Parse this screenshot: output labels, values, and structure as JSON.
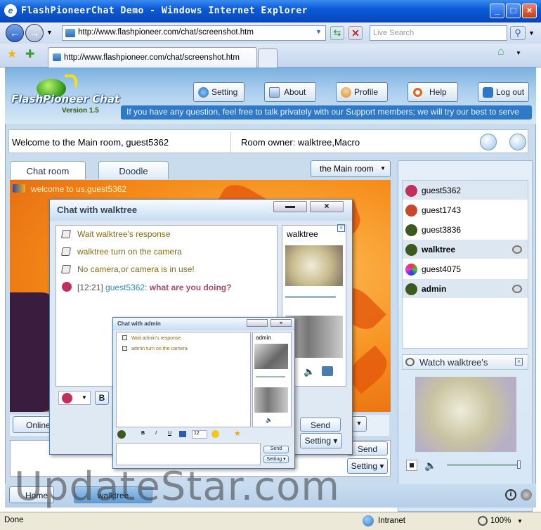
{
  "window": {
    "title": "FlashPioneerChat Demo - Windows Internet Explorer"
  },
  "browser": {
    "address": "http://www.flashpioneer.com/chat/screenshot.htm",
    "tab_title": "http://www.flashpioneer.com/chat/screenshot.htm",
    "search_placeholder": "Live Search",
    "status_text": "Done",
    "zone": "Intranet",
    "zoom": "100%"
  },
  "app": {
    "logo": "FlashPioneer Chat",
    "version": "Version 1.5",
    "nav": [
      {
        "label": "Setting"
      },
      {
        "label": "About"
      },
      {
        "label": "Profile"
      },
      {
        "label": "Help"
      },
      {
        "label": "Log out"
      }
    ],
    "notice": "If you have any question, feel free to talk privately with our Support members; we will try our best to serve",
    "welcome": "Welcome to the Main room, guest5362",
    "room_owner": "Room owner: walktree,Macro",
    "tabs": [
      "Chat room",
      "Doodle"
    ],
    "room_select": "the Main room",
    "welcome_message": "welcome to us,guest5362",
    "users": [
      {
        "name": "guest5362",
        "avatar_color": "#c0305a"
      },
      {
        "name": "guest1743",
        "avatar_color": "#c8482a"
      },
      {
        "name": "guest3836",
        "avatar_color": "#3d5a1e"
      },
      {
        "name": "walktree",
        "avatar_color": "#3d5a1e"
      },
      {
        "name": "guest4075",
        "avatar_color": "#2f7fd0"
      },
      {
        "name": "admin",
        "avatar_color": "#3d5a1e"
      }
    ],
    "watch_title": "Watch walktree's",
    "send_label": "Send",
    "setting_label": "Setting",
    "online_label": "Online",
    "bottom_tabs": [
      "Home",
      "walktree"
    ]
  },
  "chat_walktree": {
    "title": "Chat with walktree",
    "messages": [
      "Wait walktree's response",
      "walktree turn on the camera",
      "No camera,or camera is in use!"
    ],
    "user_msg": {
      "time": "[12:21]",
      "user": "guest5362:",
      "text": "what are you doing?"
    },
    "peer": "walktree",
    "bold_label": "B",
    "send": "Send",
    "setting": "Setting"
  },
  "chat_admin": {
    "title": "Chat with admin",
    "messages": [
      "Wait admin's response",
      "admin turn on the camera"
    ],
    "peer": "admin",
    "font_size": "12",
    "send": "Send",
    "setting": "Setting"
  },
  "watermark": "UpdateStar.com"
}
